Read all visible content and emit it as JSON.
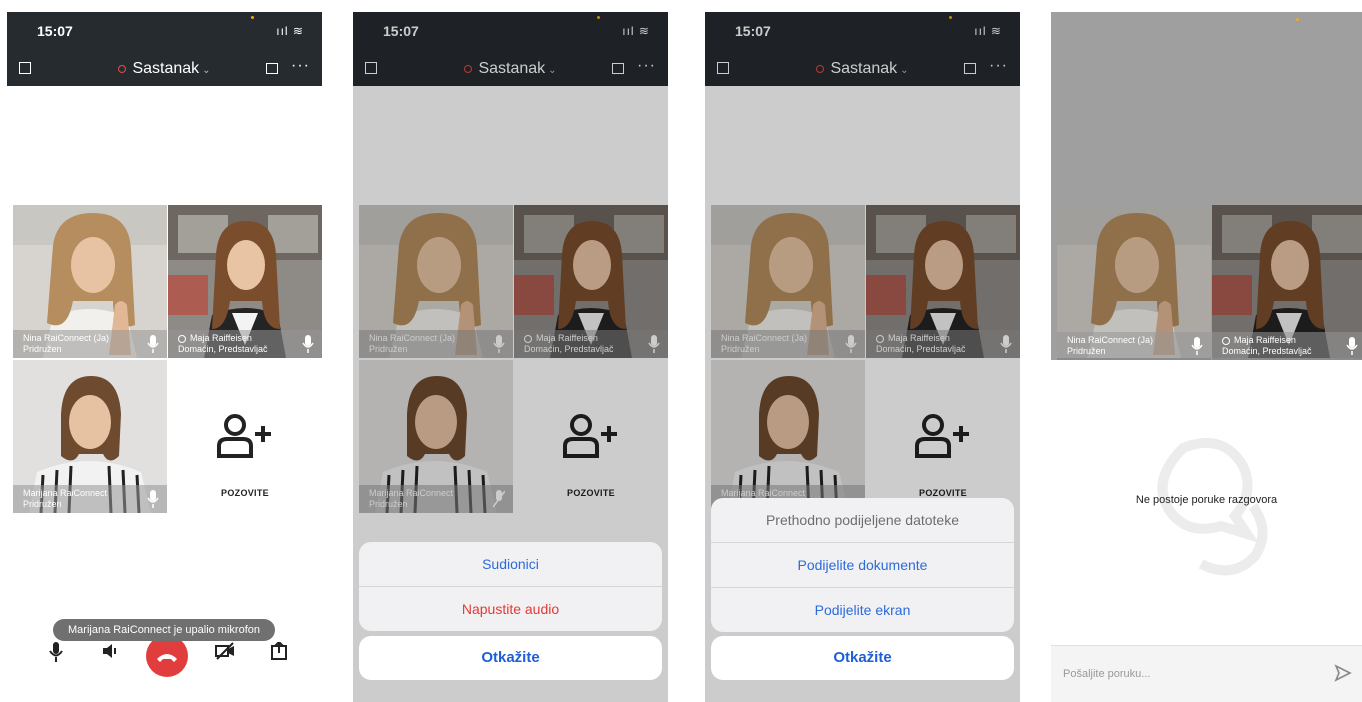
{
  "status": {
    "time": "15:07",
    "signal": "ııl ≋"
  },
  "header": {
    "title": "Sastanak",
    "chevron": "⌄",
    "more": "···"
  },
  "participants": [
    {
      "name": "Nina RaiConnect (Ja)",
      "status": "Pridružen",
      "icon": "mic-icon"
    },
    {
      "name": "Maja Raiffeisen",
      "status": "Domaćin, Predstavljač",
      "icon": "mic-icon"
    },
    {
      "name": "Marijana RaiConnect",
      "status": "Pridružen",
      "icon": "mic-icon"
    }
  ],
  "invite": {
    "label": "POZOVITE",
    "icon": "add-person-icon"
  },
  "toast": "Marijana RaiConnect je upalio mikrofon",
  "toolbar": {
    "icons": [
      "mic-icon",
      "speaker-icon",
      "end-call-icon",
      "video-off-icon",
      "share-icon"
    ]
  },
  "sheet1": {
    "participants": "Sudionici",
    "leave_audio": "Napustite audio",
    "cancel": "Otkažite"
  },
  "sheet2": {
    "prev_files": "Prethodno podijeljene datoteke",
    "share_docs": "Podijelite dokumente",
    "share_screen": "Podijelite ekran",
    "cancel": "Otkažite"
  },
  "chat": {
    "empty": "Ne postoje poruke razgovora",
    "placeholder": "Pošaljite poruku..."
  },
  "colors": {
    "header": "#262b30",
    "accent_blue": "#2c6bd9",
    "accent_red": "#e53935",
    "end_call": "#e23d3d"
  }
}
